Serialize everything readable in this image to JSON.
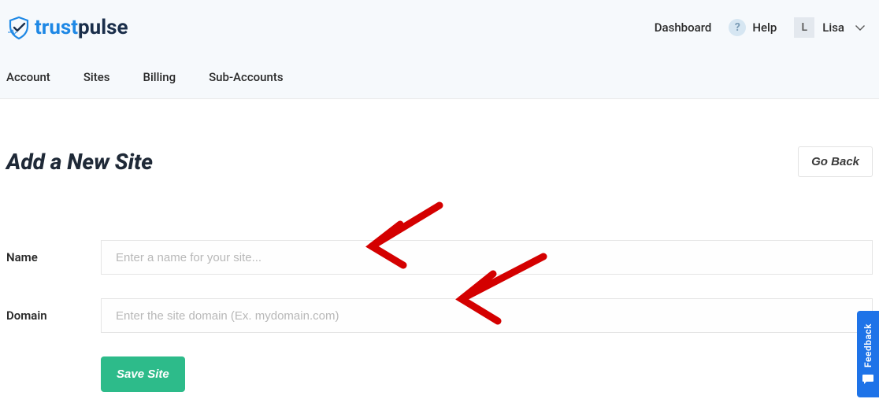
{
  "brand": {
    "trust": "trust",
    "pulse": "pulse"
  },
  "topbar": {
    "dashboard": "Dashboard",
    "help": "Help",
    "help_badge": "?",
    "user_initial": "L",
    "user_name": "Lisa"
  },
  "nav": {
    "items": [
      "Account",
      "Sites",
      "Billing",
      "Sub-Accounts"
    ]
  },
  "page": {
    "title": "Add a New Site",
    "go_back": "Go Back"
  },
  "form": {
    "name_label": "Name",
    "name_placeholder": "Enter a name for your site...",
    "domain_label": "Domain",
    "domain_placeholder": "Enter the site domain (Ex. mydomain.com)",
    "save_button": "Save Site"
  },
  "feedback": {
    "label": "Feedback"
  }
}
